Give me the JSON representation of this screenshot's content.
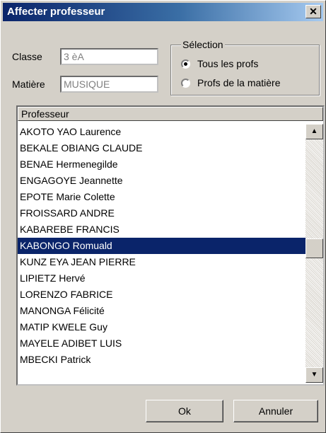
{
  "window": {
    "title": "Affecter professeur",
    "close_glyph": "✕"
  },
  "form": {
    "classe_label": "Classe",
    "classe_value": "3 èA",
    "matiere_label": "Matière",
    "matiere_value": "MUSIQUE"
  },
  "selection": {
    "title": "Sélection",
    "options": [
      {
        "label": "Tous les profs",
        "checked": true
      },
      {
        "label": "Profs de la matière",
        "checked": false
      }
    ]
  },
  "list": {
    "header": "Professeur",
    "selected_index": 7,
    "items": [
      "AKOTO YAO Laurence",
      "BEKALE OBIANG CLAUDE",
      "BENAE Hermenegilde",
      "ENGAGOYE Jeannette",
      "EPOTE Marie Colette",
      "FROISSARD ANDRE",
      "KABAREBE FRANCIS",
      "KABONGO Romuald",
      "KUNZ EYA JEAN PIERRE",
      "LIPIETZ Hervé",
      "LORENZO FABRICE",
      "MANONGA Félicité",
      "MATIP KWELE Guy",
      "MAYELE ADIBET LUIS",
      "MBECKI Patrick"
    ],
    "scroll_up_icon": "▲",
    "scroll_down_icon": "▼"
  },
  "buttons": {
    "ok": "Ok",
    "cancel": "Annuler"
  },
  "colors": {
    "titlebar": "#0a246a",
    "selection": "#0a246a",
    "face": "#d4d0c8"
  }
}
